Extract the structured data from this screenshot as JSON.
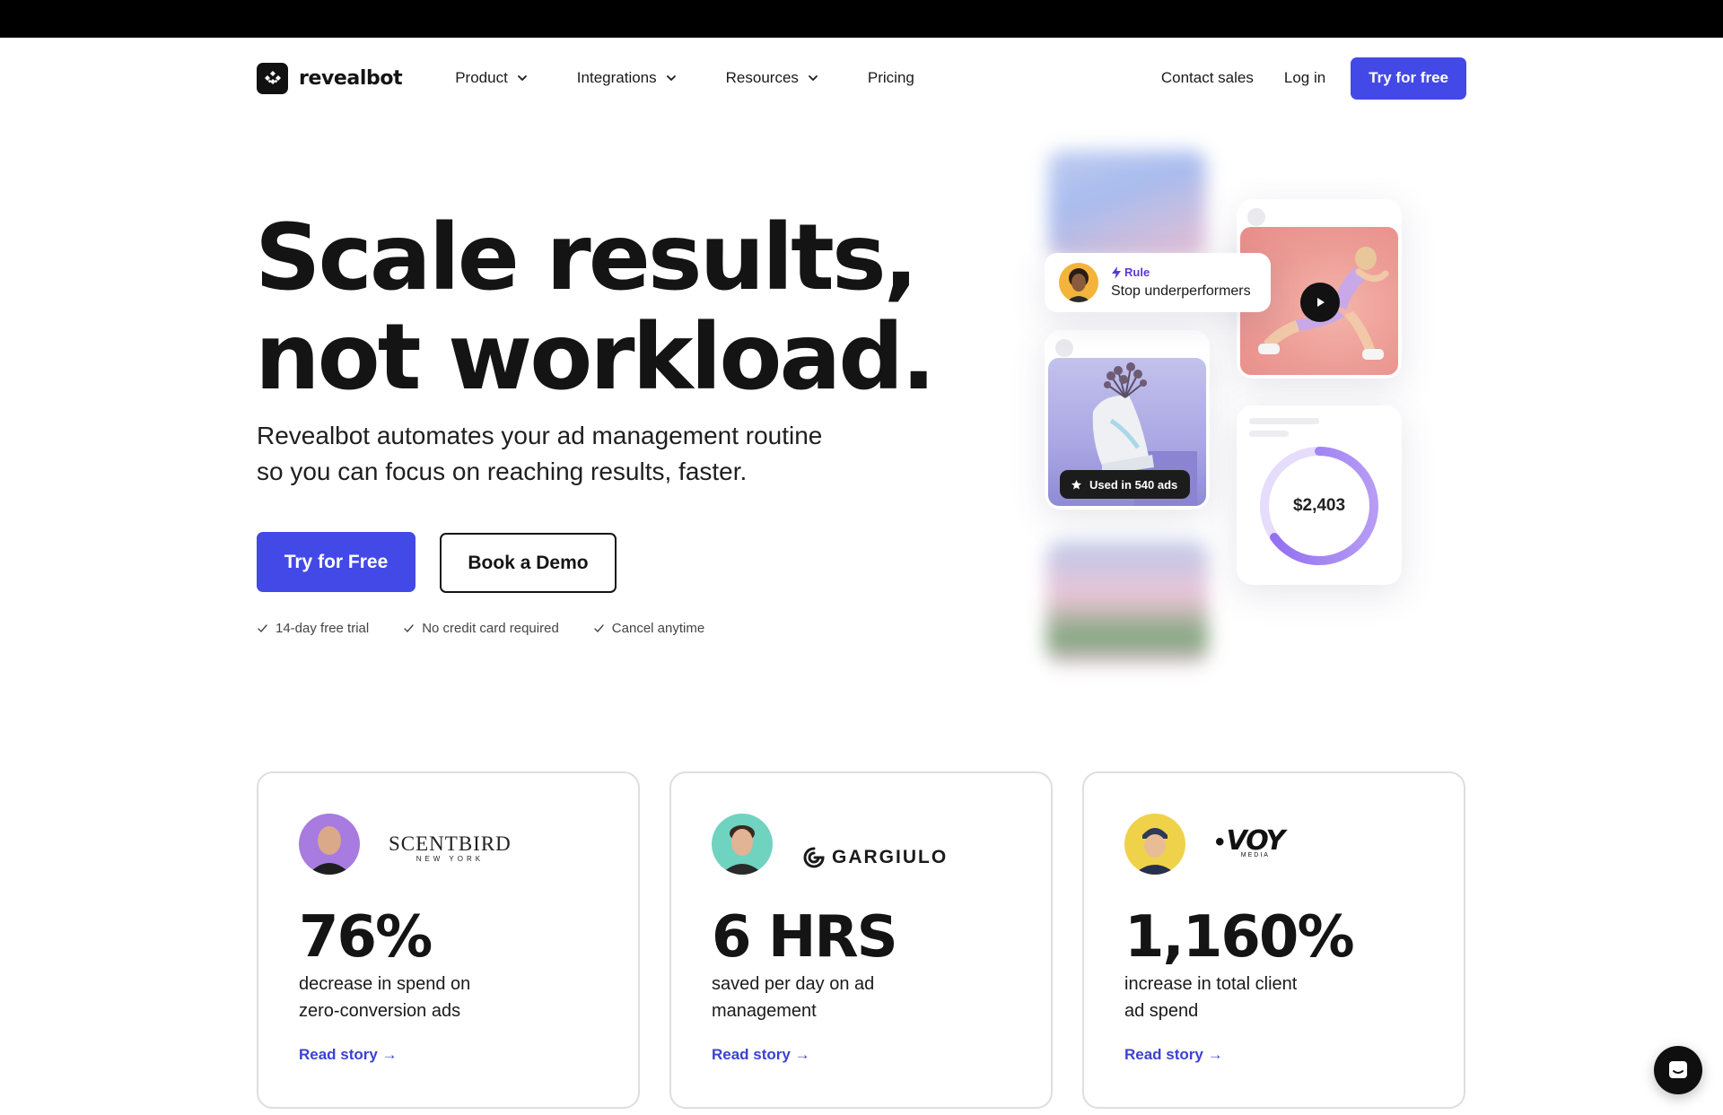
{
  "nav": {
    "logo_text": "revealbot",
    "menu": [
      {
        "label": "Product"
      },
      {
        "label": "Integrations"
      },
      {
        "label": "Resources"
      },
      {
        "label": "Pricing"
      }
    ],
    "contact_sales": "Contact sales",
    "login": "Log in",
    "cta": "Try for free"
  },
  "hero": {
    "title_line1": "Scale results,",
    "title_line2": "not workload.",
    "subtitle_line1": "Revealbot automates your ad management routine",
    "subtitle_line2": "so you can focus on reaching results, faster.",
    "primary_cta": "Try for Free",
    "secondary_cta": "Book a Demo",
    "perks": [
      "14-day free trial",
      "No credit card required",
      "Cancel anytime"
    ]
  },
  "collage": {
    "rule_tag": "Rule",
    "rule_text": "Stop underperformers",
    "used_badge": "Used in 540 ads",
    "donut_value": "$2,403",
    "accent_color": "#8f6cf0"
  },
  "stats": [
    {
      "brand": "SCENTBIRD",
      "brand_sub": "NEW YORK",
      "value": "76%",
      "desc_line1": "decrease in spend on",
      "desc_line2": "zero-conversion ads",
      "link": "Read story →",
      "avatar_color": "#a77be0"
    },
    {
      "brand": "GARGIULO",
      "value": "6 HRS",
      "desc_line1": "saved per day on ad",
      "desc_line2": "management",
      "link": "Read story →",
      "avatar_color": "#6fd3c0"
    },
    {
      "brand": "VOY",
      "brand_sub": "MEDIA",
      "value": "1,160%",
      "desc_line1": "increase in total client",
      "desc_line2": "ad spend",
      "link": "Read story →",
      "avatar_color": "#f0d24a"
    }
  ],
  "colors": {
    "brand_blue": "#4349e6",
    "link_blue": "#3c42d0",
    "text": "#141414"
  }
}
